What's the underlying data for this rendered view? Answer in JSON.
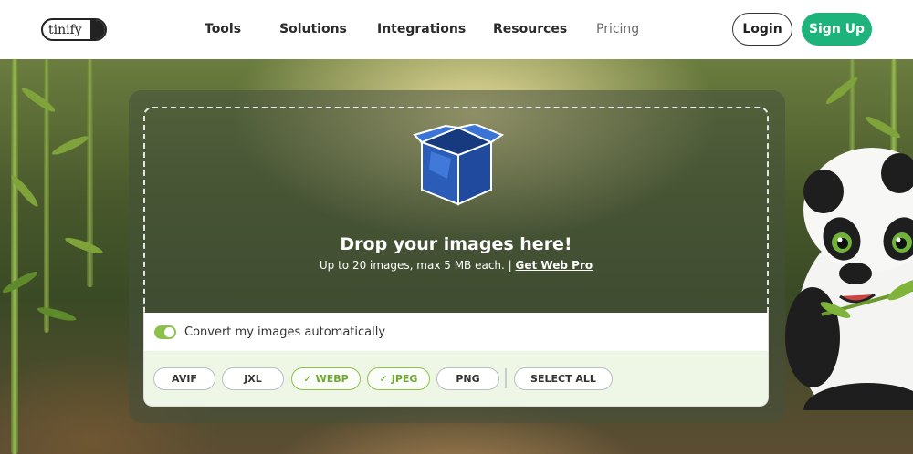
{
  "header": {
    "logo_text": "tinify",
    "nav": [
      "Tools",
      "Solutions",
      "Integrations",
      "Resources",
      "Pricing"
    ],
    "login_label": "Login",
    "signup_label": "Sign Up"
  },
  "upload": {
    "title": "Drop your images here!",
    "subtitle": "Up to 20 images, max 5 MB each. | ",
    "subtitle_link": "Get Web Pro",
    "box_icon": "open-box-icon"
  },
  "convert": {
    "label": "Convert my images automatically",
    "enabled": true
  },
  "formats": [
    {
      "label": "AVIF",
      "selected": false
    },
    {
      "label": "JXL",
      "selected": false
    },
    {
      "label": "WEBP",
      "selected": true
    },
    {
      "label": "JPEG",
      "selected": true
    },
    {
      "label": "PNG",
      "selected": false
    }
  ],
  "select_all_label": "SELECT ALL",
  "colors": {
    "brand_green": "#1db37a",
    "toggle_green": "#8bc34a",
    "box_blue": "#2a5cb8"
  }
}
